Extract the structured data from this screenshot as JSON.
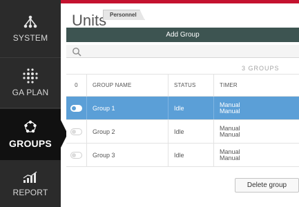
{
  "nav": {
    "items": [
      {
        "label": "SYSTEM",
        "icon": "network-tree-icon"
      },
      {
        "label": "GA PLAN",
        "icon": "dot-grid-icon"
      },
      {
        "label": "GROUPS",
        "icon": "groups-circle-icon"
      },
      {
        "label": "REPORT",
        "icon": "chart-icon"
      }
    ],
    "active": "GROUPS"
  },
  "header": {
    "title": "Units",
    "tab": "Personnel"
  },
  "toolbar": {
    "add_group_label": "Add Group",
    "delete_group_label": "Delete group"
  },
  "search": {
    "placeholder": "",
    "value": ""
  },
  "groups_count": "3 GROUPS",
  "table": {
    "columns": [
      "0",
      "GROUP NAME",
      "STATUS",
      "TIMER"
    ],
    "rows": [
      {
        "name": "Group 1",
        "status": "Idle",
        "timer_line1": "Manual",
        "timer_line2": "Manual",
        "selected": true
      },
      {
        "name": "Group 2",
        "status": "Idle",
        "timer_line1": "Manual",
        "timer_line2": "Manual",
        "selected": false
      },
      {
        "name": "Group 3",
        "status": "Idle",
        "timer_line1": "Manual",
        "timer_line2": "Manual",
        "selected": false
      }
    ]
  },
  "colors": {
    "accent_red": "#c4122f",
    "nav_bg": "#2b2b2b",
    "button_bg": "#3d5451",
    "selection_blue": "#5b9fd7"
  }
}
